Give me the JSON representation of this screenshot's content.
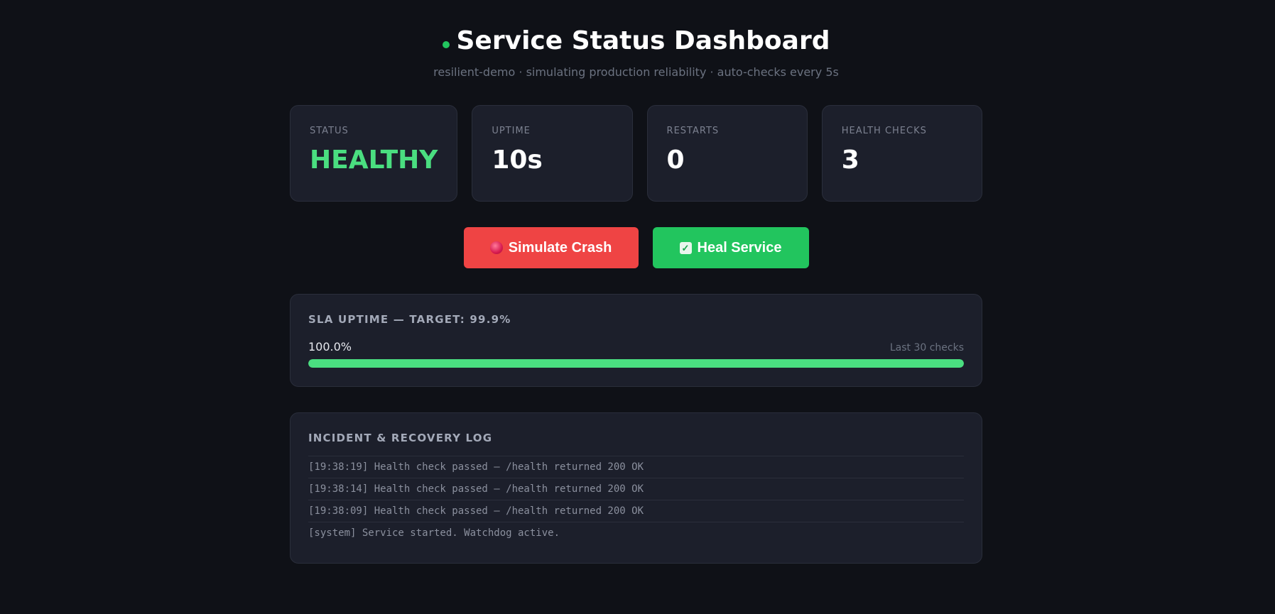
{
  "header": {
    "title": "Service Status Dashboard",
    "subtitle": "resilient-demo · simulating production reliability · auto-checks every 5s",
    "status_dot_color": "#22c55e"
  },
  "stats": [
    {
      "label": "STATUS",
      "value": "HEALTHY"
    },
    {
      "label": "UPTIME",
      "value": "10s"
    },
    {
      "label": "RESTARTS",
      "value": "0"
    },
    {
      "label": "HEALTH CHECKS",
      "value": "3"
    }
  ],
  "actions": {
    "crash_label": "Simulate Crash",
    "heal_label": "Heal Service",
    "crash_icon": "red-ball-icon",
    "heal_icon": "check-box-icon"
  },
  "sla": {
    "title": "SLA UPTIME — TARGET: 99.9%",
    "percent_text": "100.0%",
    "note": "Last 30 checks",
    "fill_percent": 100
  },
  "log": {
    "title": "INCIDENT & RECOVERY LOG",
    "entries": [
      "[19:38:19] Health check passed — /health returned 200 OK",
      "[19:38:14] Health check passed — /health returned 200 OK",
      "[19:38:09] Health check passed — /health returned 200 OK",
      "[system] Service started. Watchdog active."
    ]
  },
  "colors": {
    "healthy": "#4ade80",
    "crash": "#ef4444",
    "heal": "#22c55e",
    "background": "#0f1117",
    "panel": "#1c1f2b"
  }
}
